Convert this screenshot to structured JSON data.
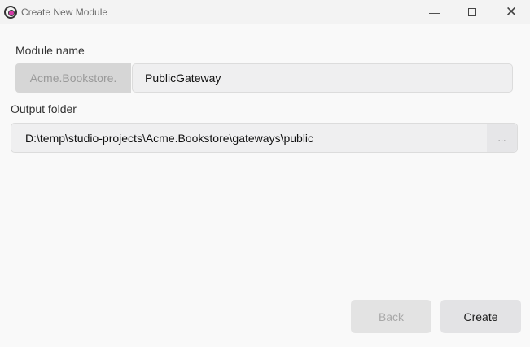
{
  "window": {
    "title": "Create New Module",
    "minimize_icon": "minimize-icon",
    "maximize_icon": "maximize-icon",
    "close_icon": "close-icon"
  },
  "form": {
    "module_name_label": "Module name",
    "module_prefix": "Acme.Bookstore.",
    "module_name_value": "PublicGateway",
    "output_folder_label": "Output folder",
    "output_folder_value": "D:\\temp\\studio-projects\\Acme.Bookstore\\gateways\\public",
    "browse_label": "..."
  },
  "footer": {
    "back_label": "Back",
    "create_label": "Create"
  }
}
